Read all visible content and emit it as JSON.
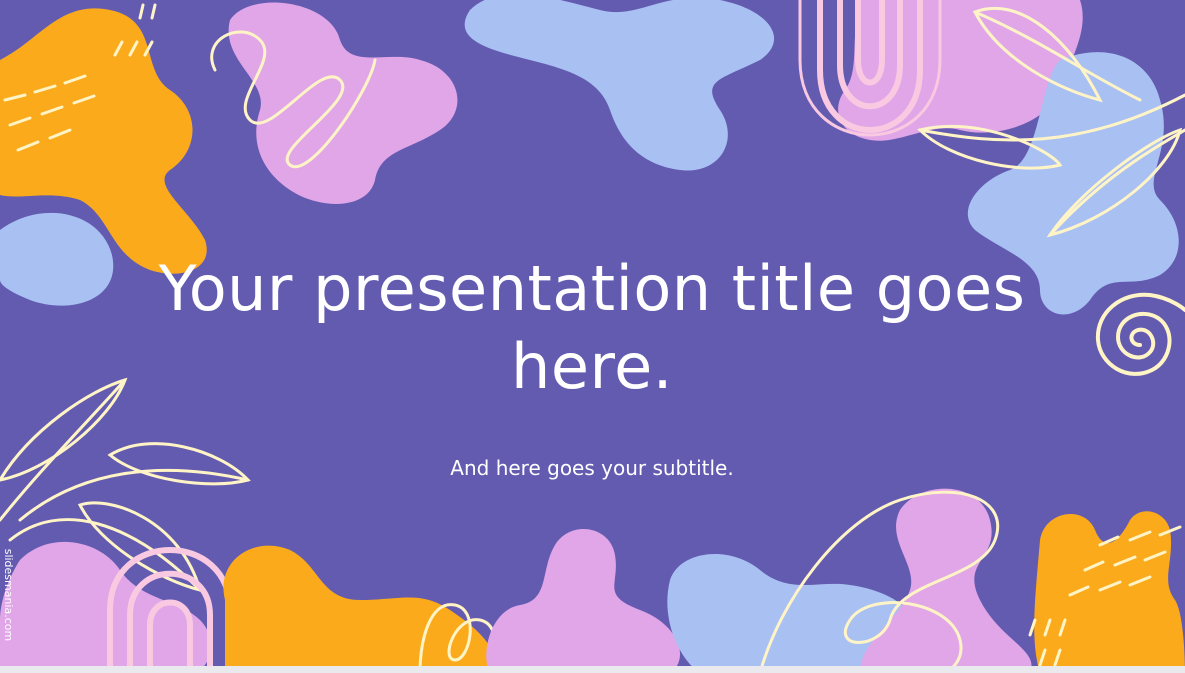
{
  "slide": {
    "title": "Your presentation title goes here.",
    "subtitle": "And here goes your subtitle.",
    "credit": "slidesmania.com"
  },
  "colors": {
    "background": "#635bb0",
    "orange": "#fbaa1c",
    "lilac": "#e0a6e8",
    "light_blue": "#a9c0f3",
    "pink": "#f9c9e1",
    "cream": "#fff4c6"
  }
}
